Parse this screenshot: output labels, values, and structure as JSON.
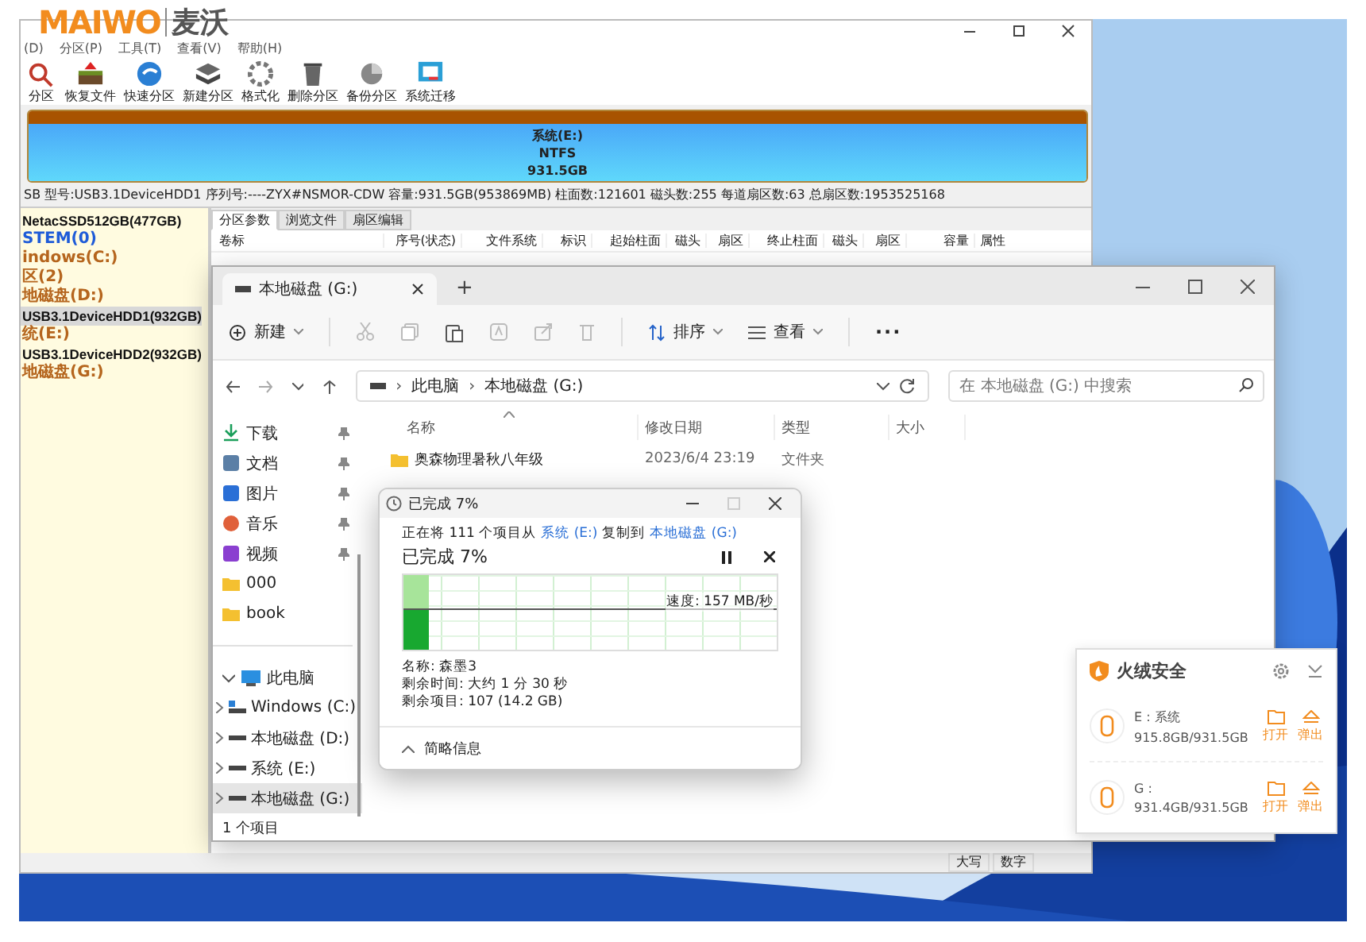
{
  "logo": {
    "brand": "MAIWO",
    "brand_cn": "麦沃"
  },
  "diskgenius": {
    "menu": [
      "(D)",
      "分区(P)",
      "工具(T)",
      "查看(V)",
      "帮助(H)"
    ],
    "toolbar": [
      {
        "label": "分区",
        "kind": "search"
      },
      {
        "label": "恢复文件",
        "kind": "restore"
      },
      {
        "label": "快速分区",
        "kind": "quick"
      },
      {
        "label": "新建分区",
        "kind": "new"
      },
      {
        "label": "格式化",
        "kind": "format"
      },
      {
        "label": "删除分区",
        "kind": "delete"
      },
      {
        "label": "备份分区",
        "kind": "backup"
      },
      {
        "label": "系统迁移",
        "kind": "migrate"
      }
    ],
    "disk_bar": {
      "name": "系统(E:)",
      "fs": "NTFS",
      "size": "931.5GB"
    },
    "disk_info": "SB  型号:USB3.1DeviceHDD1  序列号:----ZYX#NSMOR-CDW  容量:931.5GB(953869MB)  柱面数:121601  磁头数:255  每道扇区数:63  总扇区数:1953525168",
    "tree": [
      {
        "label": "NetacSSD512GB(477GB)",
        "kind": "disk",
        "selected": false
      },
      {
        "label": "STEM(0)",
        "kind": "partition",
        "color": "#1e5bd8",
        "selected": false
      },
      {
        "label": "indows(C:)",
        "kind": "partition",
        "color": "#b5651d",
        "selected": false
      },
      {
        "label": "区(2)",
        "kind": "partition",
        "color": "#b5651d",
        "selected": false
      },
      {
        "label": "地磁盘(D:)",
        "kind": "partition",
        "color": "#b5651d",
        "selected": false
      },
      {
        "label": "USB3.1DeviceHDD1(932GB)",
        "kind": "disk",
        "selected": true
      },
      {
        "label": "统(E:)",
        "kind": "partition",
        "color": "#b5651d",
        "selected": false
      },
      {
        "label": "USB3.1DeviceHDD2(932GB)",
        "kind": "disk",
        "selected": false
      },
      {
        "label": "地磁盘(G:)",
        "kind": "partition",
        "color": "#b5651d",
        "selected": false
      }
    ],
    "tabs": [
      {
        "label": "分区参数",
        "selected": true
      },
      {
        "label": "浏览文件",
        "selected": false
      },
      {
        "label": "扇区编辑",
        "selected": false
      }
    ],
    "columns": [
      "卷标",
      "序号(状态)",
      "文件系统",
      "标识",
      "起始柱面",
      "磁头",
      "扇区",
      "终止柱面",
      "磁头",
      "扇区",
      "容量",
      "属性"
    ],
    "status": [
      "大写",
      "数字"
    ]
  },
  "explorer": {
    "tab": "本地磁盘 (G:)",
    "new_tab": "+",
    "toolbar": [
      {
        "label": "新建",
        "kind": "new"
      },
      {
        "kind": "cut"
      },
      {
        "kind": "copy"
      },
      {
        "kind": "paste"
      },
      {
        "kind": "rename"
      },
      {
        "kind": "share"
      },
      {
        "kind": "delete"
      },
      {
        "label": "排序",
        "kind": "sort"
      },
      {
        "label": "查看",
        "kind": "view"
      },
      {
        "label": "···",
        "kind": "more"
      }
    ],
    "address": {
      "separator": "›",
      "crumbs": [
        "此电脑",
        "本地磁盘 (G:)"
      ]
    },
    "search": {
      "placeholder": "在 本地磁盘 (G:) 中搜索"
    },
    "quick": [
      {
        "label": "下载",
        "kind": "download",
        "pinned": true
      },
      {
        "label": "文档",
        "kind": "document",
        "pinned": true
      },
      {
        "label": "图片",
        "kind": "picture",
        "pinned": true
      },
      {
        "label": "音乐",
        "kind": "music",
        "pinned": true
      },
      {
        "label": "视频",
        "kind": "video",
        "pinned": true
      },
      {
        "label": "000",
        "kind": "folder",
        "pinned": false
      },
      {
        "label": "book",
        "kind": "folder",
        "pinned": false
      }
    ],
    "tree": {
      "label": "此电脑",
      "expanded": true,
      "children": [
        {
          "label": "Windows (C:)",
          "kind": "windows",
          "selected": false
        },
        {
          "label": "本地磁盘 (D:)",
          "kind": "drive",
          "selected": false
        },
        {
          "label": "系统 (E:)",
          "kind": "drive",
          "selected": false
        },
        {
          "label": "本地磁盘 (G:)",
          "kind": "drive",
          "selected": true
        }
      ]
    },
    "columns": [
      "名称",
      "修改日期",
      "类型",
      "大小"
    ],
    "rows": [
      {
        "name": "奥森物理暑秋八年级",
        "date": "2023/6/4 23:19",
        "type": "文件夹"
      }
    ],
    "status": "1 个项目"
  },
  "copy_dialog": {
    "title": "已完成 7%",
    "from_text": "正在将 111 个项目从",
    "source": "系统 (E:)",
    "to_text": "复制到",
    "dest": "本地磁盘 (G:)",
    "heading": "已完成 7%",
    "level": 0.07,
    "speed": "速度: 157 MB/秒",
    "details": [
      "名称: 森墨3",
      "剩余时间: 大约 1 分 30 秒",
      "剩余项目: 107 (14.2 GB)"
    ],
    "footer": "简略信息"
  },
  "huorong": {
    "title": "火绒安全",
    "drives": [
      {
        "name": "E : 系统",
        "usage": "915.8GB/931.5GB",
        "open": "打开",
        "eject": "弹出"
      },
      {
        "name": "G :",
        "usage": "931.4GB/931.5GB",
        "open": "打开",
        "eject": "弹出"
      }
    ]
  }
}
